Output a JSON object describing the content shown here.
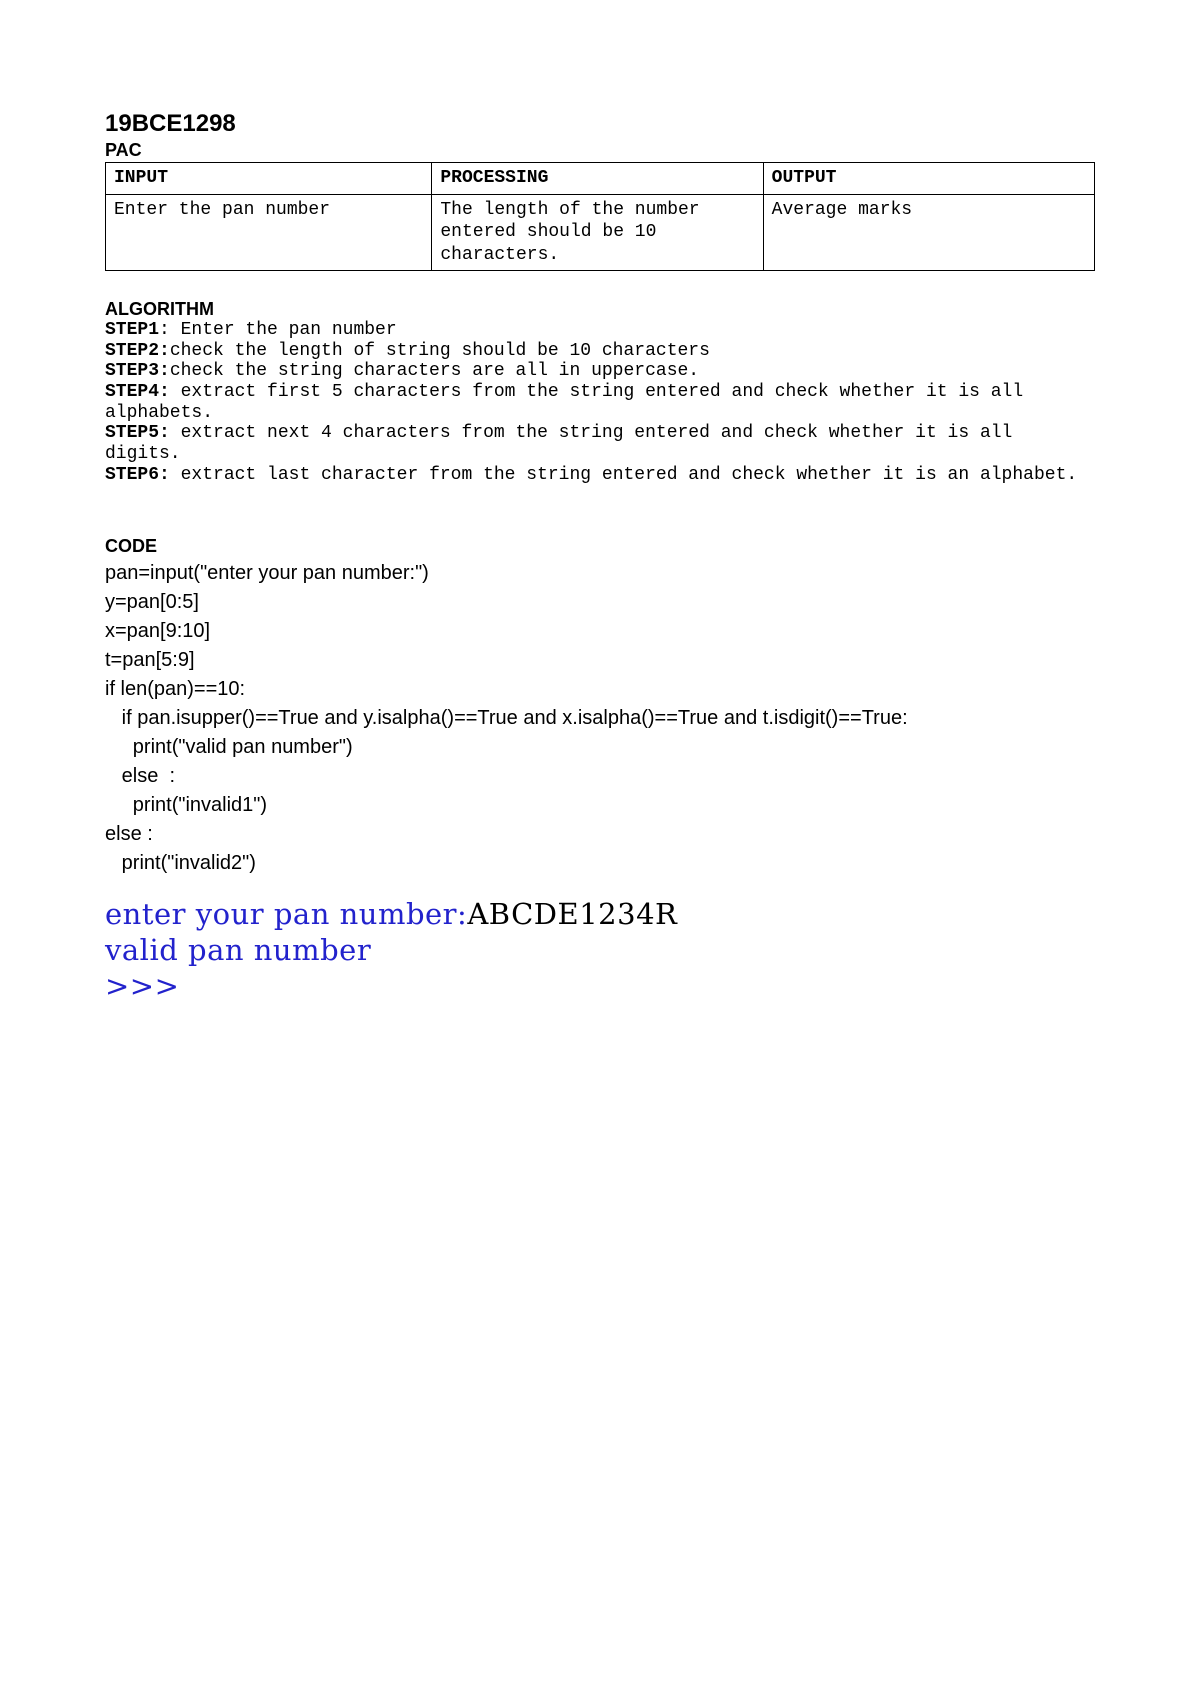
{
  "heading": "19BCE1298",
  "pac_label": "PAC",
  "table": {
    "headers": [
      "INPUT",
      "PROCESSING",
      "OUTPUT"
    ],
    "row": {
      "input": "Enter the pan number",
      "processing": "The length of the number entered should be 10 characters.",
      "output": "Average marks"
    }
  },
  "algorithm": {
    "heading": "ALGORITHM",
    "steps": [
      {
        "label": "STEP1",
        "sep": ": ",
        "text": "Enter the pan number"
      },
      {
        "label": "STEP2:",
        "sep": "",
        "text": "check the length of string should be 10 characters"
      },
      {
        "label": "STEP3:",
        "sep": "",
        "text": "check the string characters are all in uppercase."
      },
      {
        "label": "STEP4:",
        "sep": " ",
        "text": "extract first 5 characters from the string entered and check whether it is all alphabets."
      },
      {
        "label": "STEP5:",
        "sep": " ",
        "text": "extract next 4 characters from the string entered and check whether it is all digits."
      },
      {
        "label": "STEP6:",
        "sep": " ",
        "text": "extract last character from the string entered and check whether it is an alphabet."
      }
    ]
  },
  "code": {
    "heading": "CODE",
    "body": "pan=input(\"enter your pan number:\")\ny=pan[0:5]\nx=pan[9:10]\nt=pan[5:9]\nif len(pan)==10:\n   if pan.isupper()==True and y.isalpha()==True and x.isalpha()==True and t.isdigit()==True:\n     print(\"valid pan number\")\n   else  :\n     print(\"invalid1\")\nelse :\n   print(\"invalid2\")"
  },
  "console": {
    "line1_prompt": "enter your pan number:",
    "line1_input": "ABCDE1234R",
    "line2": "valid pan number",
    "line3": ">>>"
  }
}
